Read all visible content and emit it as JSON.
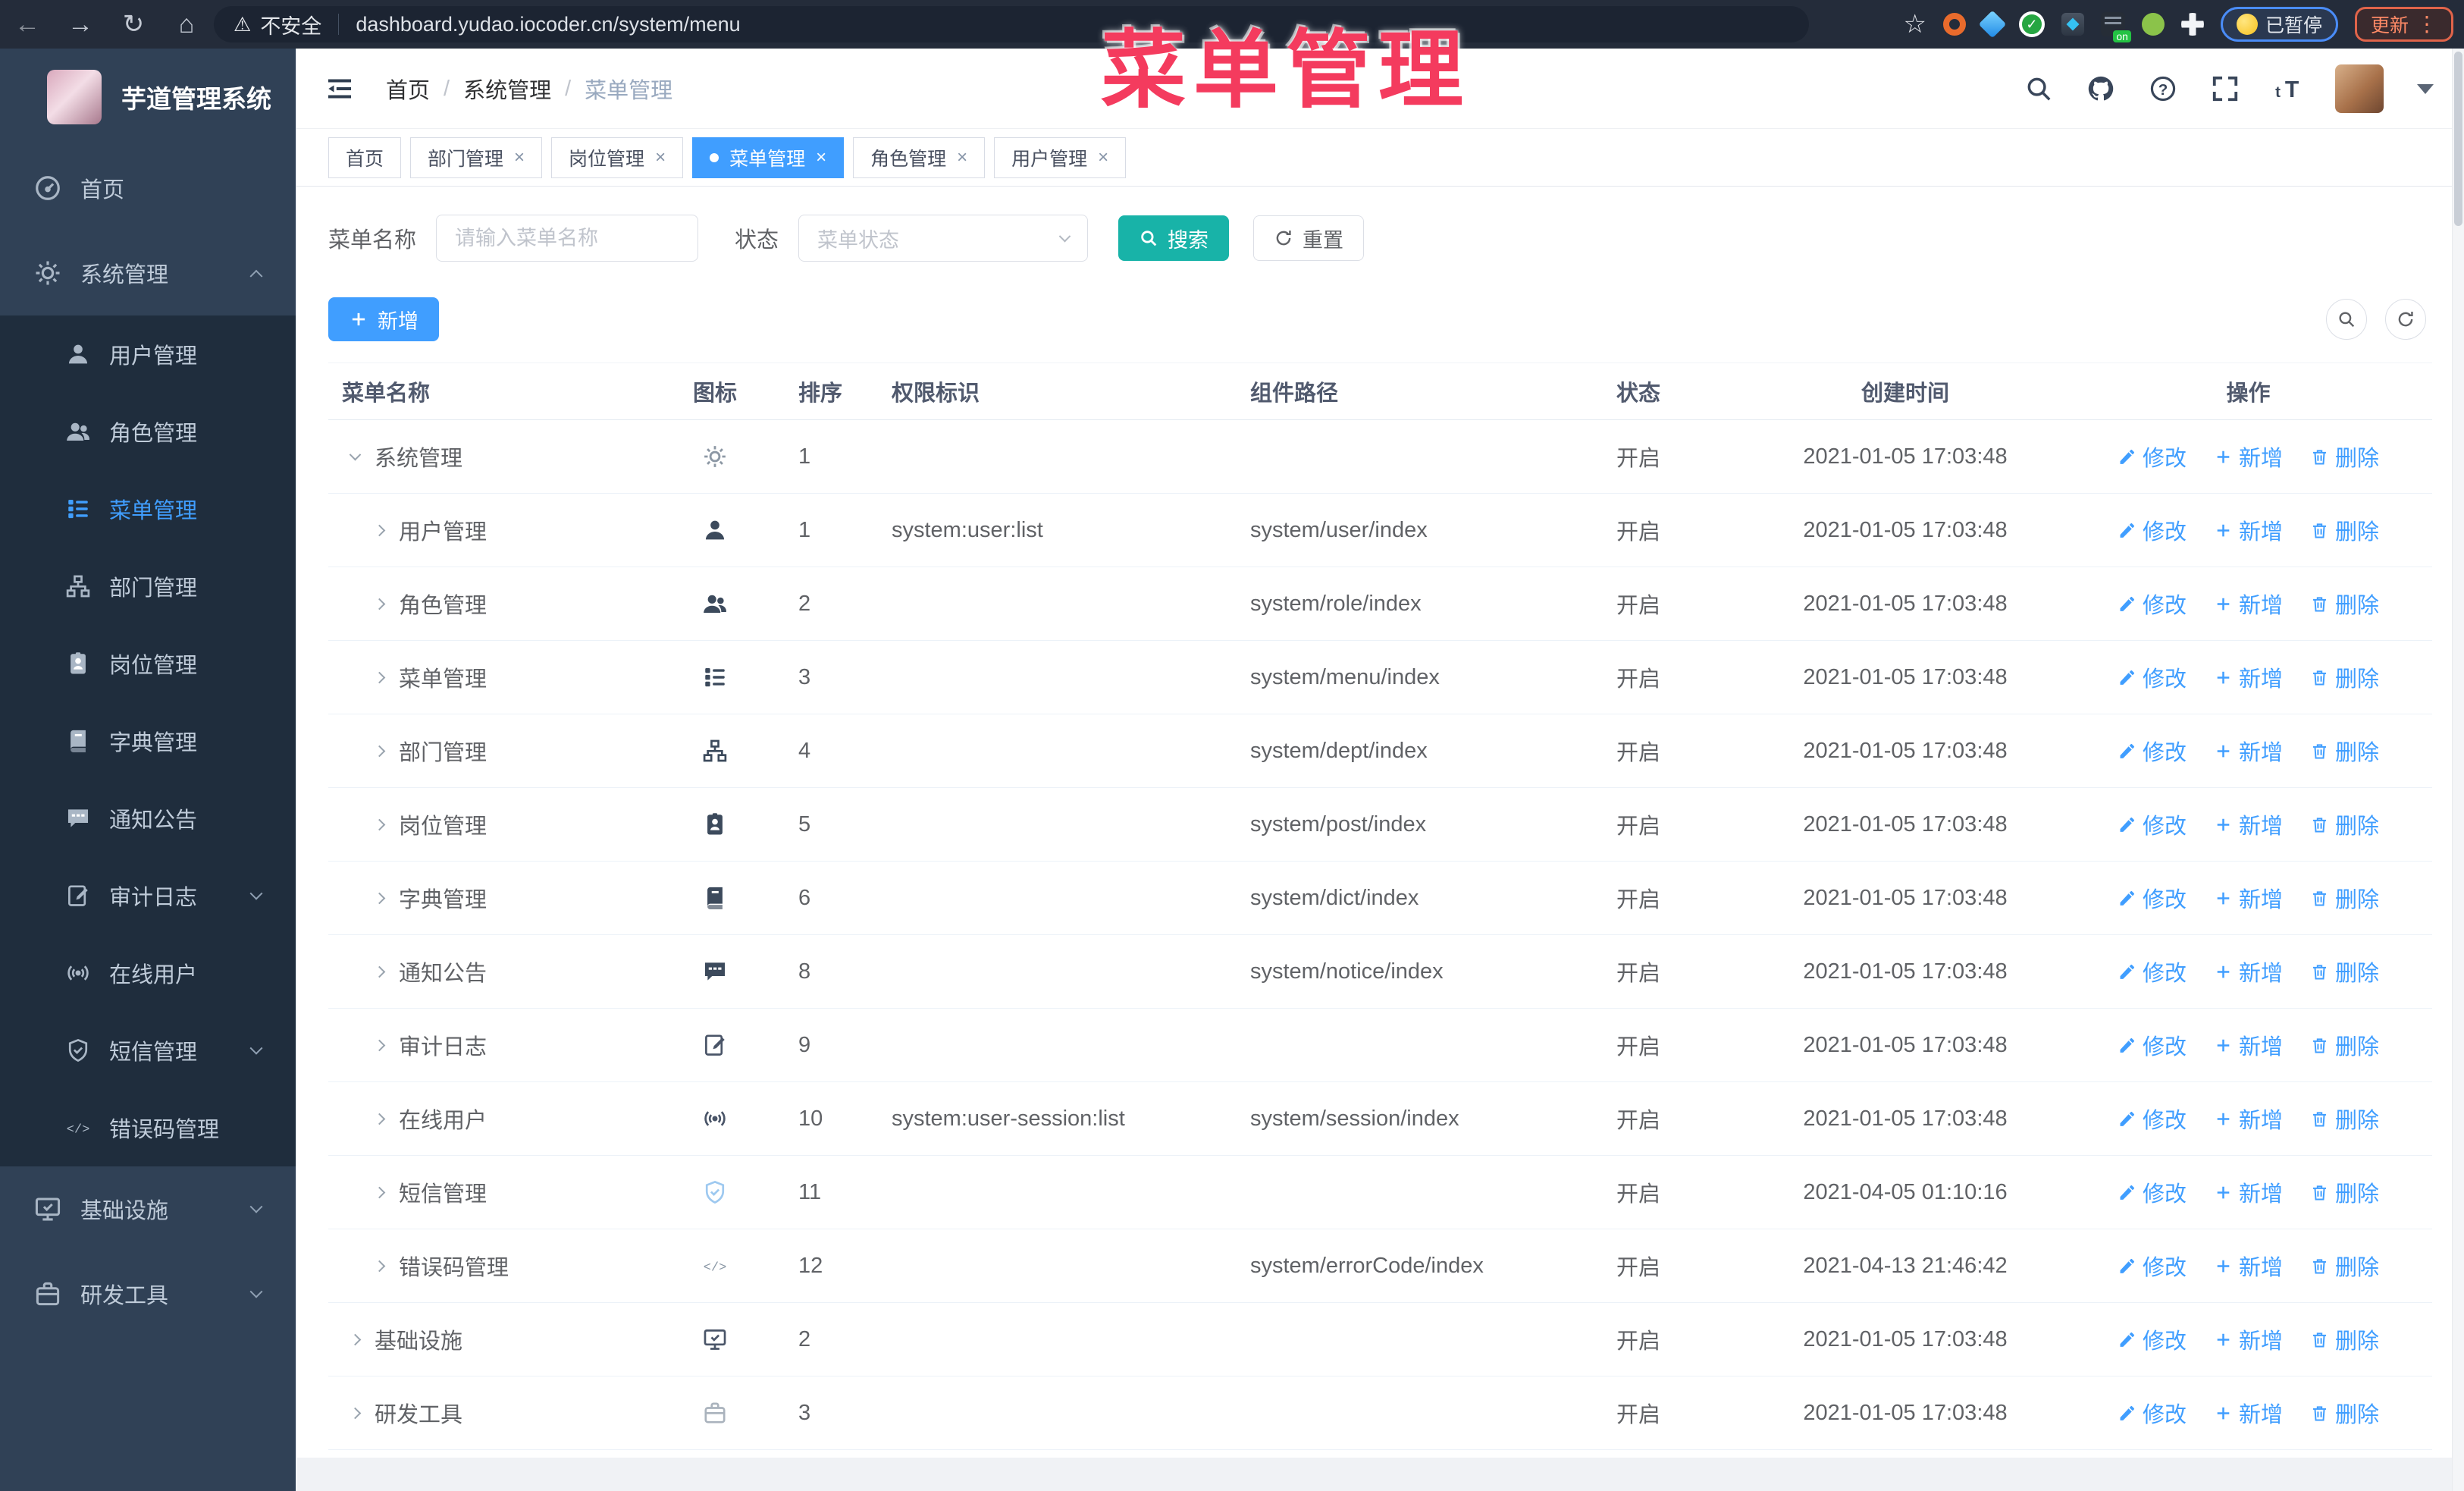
{
  "browser": {
    "security_text": "不安全",
    "url": "dashboard.yudao.iocoder.cn/system/menu",
    "paused_badge": "已暂停",
    "update_badge": "更新",
    "on_badge": "on"
  },
  "watermark": "菜单管理",
  "sidebar": {
    "title": "芋道管理系统",
    "items": [
      {
        "label": "首页",
        "icon": "dashboard",
        "children": null,
        "arrow": null,
        "active": false
      },
      {
        "label": "系统管理",
        "icon": "gear",
        "arrow": "up",
        "active": false,
        "children": [
          {
            "label": "用户管理",
            "icon": "user",
            "active": false,
            "arrow": null
          },
          {
            "label": "角色管理",
            "icon": "users",
            "active": false,
            "arrow": null
          },
          {
            "label": "菜单管理",
            "icon": "menu",
            "active": true,
            "arrow": null
          },
          {
            "label": "部门管理",
            "icon": "tree",
            "active": false,
            "arrow": null
          },
          {
            "label": "岗位管理",
            "icon": "badge",
            "active": false,
            "arrow": null
          },
          {
            "label": "字典管理",
            "icon": "book",
            "active": false,
            "arrow": null
          },
          {
            "label": "通知公告",
            "icon": "chat",
            "active": false,
            "arrow": null
          },
          {
            "label": "审计日志",
            "icon": "editnote",
            "active": false,
            "arrow": "down"
          },
          {
            "label": "在线用户",
            "icon": "signal",
            "active": false,
            "arrow": null
          },
          {
            "label": "短信管理",
            "icon": "shield",
            "active": false,
            "arrow": "down"
          },
          {
            "label": "错误码管理",
            "icon": "code",
            "active": false,
            "arrow": null
          }
        ]
      },
      {
        "label": "基础设施",
        "icon": "monitor",
        "children": null,
        "arrow": "down",
        "active": false
      },
      {
        "label": "研发工具",
        "icon": "briefcase",
        "children": null,
        "arrow": "down",
        "active": false
      }
    ]
  },
  "header": {
    "breadcrumb": [
      "首页",
      "系统管理",
      "菜单管理"
    ]
  },
  "tabs": [
    {
      "label": "首页",
      "closable": false,
      "active": false
    },
    {
      "label": "部门管理",
      "closable": true,
      "active": false
    },
    {
      "label": "岗位管理",
      "closable": true,
      "active": false
    },
    {
      "label": "菜单管理",
      "closable": true,
      "active": true
    },
    {
      "label": "角色管理",
      "closable": true,
      "active": false
    },
    {
      "label": "用户管理",
      "closable": true,
      "active": false
    }
  ],
  "filter": {
    "name_label": "菜单名称",
    "name_placeholder": "请输入菜单名称",
    "name_value": "",
    "status_label": "状态",
    "status_placeholder": "菜单状态",
    "search_label": "搜索",
    "reset_label": "重置"
  },
  "toolbar": {
    "add_label": "新增"
  },
  "table": {
    "headers": [
      "菜单名称",
      "图标",
      "排序",
      "权限标识",
      "组件路径",
      "状态",
      "创建时间",
      "操作"
    ],
    "action_labels": [
      "修改",
      "新增",
      "删除"
    ],
    "rows": [
      {
        "name": "系统管理",
        "level": 0,
        "expand": "down",
        "icon": "gear",
        "icon_color": "#8d98a5",
        "sort": "1",
        "perm": "",
        "path": "",
        "status": "开启",
        "time": "2021-01-05 17:03:48"
      },
      {
        "name": "用户管理",
        "level": 1,
        "expand": "right",
        "icon": "user",
        "icon_color": "#3c4a5c",
        "sort": "1",
        "perm": "system:user:list",
        "path": "system/user/index",
        "status": "开启",
        "time": "2021-01-05 17:03:48"
      },
      {
        "name": "角色管理",
        "level": 1,
        "expand": "right",
        "icon": "users",
        "icon_color": "#3c4a5c",
        "sort": "2",
        "perm": "",
        "path": "system/role/index",
        "status": "开启",
        "time": "2021-01-05 17:03:48"
      },
      {
        "name": "菜单管理",
        "level": 1,
        "expand": "right",
        "icon": "menu",
        "icon_color": "#3c4a5c",
        "sort": "3",
        "perm": "",
        "path": "system/menu/index",
        "status": "开启",
        "time": "2021-01-05 17:03:48"
      },
      {
        "name": "部门管理",
        "level": 1,
        "expand": "right",
        "icon": "tree",
        "icon_color": "#3c4a5c",
        "sort": "4",
        "perm": "",
        "path": "system/dept/index",
        "status": "开启",
        "time": "2021-01-05 17:03:48"
      },
      {
        "name": "岗位管理",
        "level": 1,
        "expand": "right",
        "icon": "badge",
        "icon_color": "#3c4a5c",
        "sort": "5",
        "perm": "",
        "path": "system/post/index",
        "status": "开启",
        "time": "2021-01-05 17:03:48"
      },
      {
        "name": "字典管理",
        "level": 1,
        "expand": "right",
        "icon": "book",
        "icon_color": "#3c4a5c",
        "sort": "6",
        "perm": "",
        "path": "system/dict/index",
        "status": "开启",
        "time": "2021-01-05 17:03:48"
      },
      {
        "name": "通知公告",
        "level": 1,
        "expand": "right",
        "icon": "chat",
        "icon_color": "#3c4a5c",
        "sort": "8",
        "perm": "",
        "path": "system/notice/index",
        "status": "开启",
        "time": "2021-01-05 17:03:48"
      },
      {
        "name": "审计日志",
        "level": 1,
        "expand": "right",
        "icon": "editnote",
        "icon_color": "#4a5568",
        "sort": "9",
        "perm": "",
        "path": "",
        "status": "开启",
        "time": "2021-01-05 17:03:48"
      },
      {
        "name": "在线用户",
        "level": 1,
        "expand": "right",
        "icon": "signal",
        "icon_color": "#4a5568",
        "sort": "10",
        "perm": "system:user-session:list",
        "path": "system/session/index",
        "status": "开启",
        "time": "2021-01-05 17:03:48"
      },
      {
        "name": "短信管理",
        "level": 1,
        "expand": "right",
        "icon": "shield",
        "icon_color": "#9ec9f0",
        "sort": "11",
        "perm": "",
        "path": "",
        "status": "开启",
        "time": "2021-04-05 01:10:16"
      },
      {
        "name": "错误码管理",
        "level": 1,
        "expand": "right",
        "icon": "code",
        "icon_color": "#8a97a5",
        "sort": "12",
        "perm": "",
        "path": "system/errorCode/index",
        "status": "开启",
        "time": "2021-04-13 21:46:42"
      },
      {
        "name": "基础设施",
        "level": 0,
        "expand": "right",
        "icon": "monitor",
        "icon_color": "#4a5568",
        "sort": "2",
        "perm": "",
        "path": "",
        "status": "开启",
        "time": "2021-01-05 17:03:48"
      },
      {
        "name": "研发工具",
        "level": 0,
        "expand": "right",
        "icon": "briefcase",
        "icon_color": "#aab3bd",
        "sort": "3",
        "perm": "",
        "path": "",
        "status": "开启",
        "time": "2021-01-05 17:03:48"
      }
    ]
  },
  "colors": {
    "accent": "#409eff",
    "teal": "#18b3a8",
    "pink": "#f43b5e",
    "sidebar_bg": "#304156",
    "submenu_bg": "#1f2d3d"
  }
}
